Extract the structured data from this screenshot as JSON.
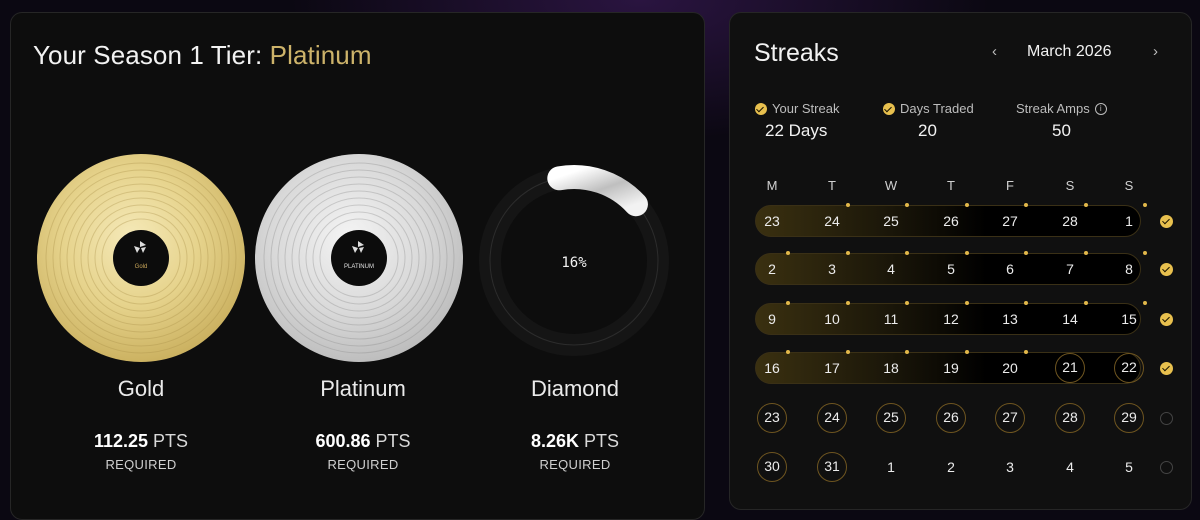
{
  "tier": {
    "title_prefix": "Your Season 1 Tier: ",
    "current": "Platinum",
    "tiers": [
      {
        "name": "Gold",
        "pts": "112.25",
        "unit": "PTS",
        "req": "REQUIRED",
        "label_text": "Gold"
      },
      {
        "name": "Platinum",
        "pts": "600.86",
        "unit": "PTS",
        "req": "REQUIRED",
        "label_text": "PLATINUM"
      },
      {
        "name": "Diamond",
        "pts": "8.26K",
        "unit": "PTS",
        "req": "REQUIRED",
        "progress_text": "16%",
        "progress": 0.16
      }
    ]
  },
  "streaks": {
    "title": "Streaks",
    "month": "March 2026",
    "your_streak_label": "Your Streak",
    "your_streak_value": "22 Days",
    "days_traded_label": "Days Traded",
    "days_traded_value": "20",
    "streak_amps_label": "Streak Amps",
    "streak_amps_value": "50",
    "weekdays": [
      "M",
      "T",
      "W",
      "T",
      "F",
      "S",
      "S"
    ],
    "weeks": [
      {
        "days": [
          "23",
          "24",
          "25",
          "26",
          "27",
          "28",
          "1"
        ],
        "completed": true
      },
      {
        "days": [
          "2",
          "3",
          "4",
          "5",
          "6",
          "7",
          "8"
        ],
        "completed": true
      },
      {
        "days": [
          "9",
          "10",
          "11",
          "12",
          "13",
          "14",
          "15"
        ],
        "completed": true
      },
      {
        "days": [
          "16",
          "17",
          "18",
          "19",
          "20",
          "21",
          "22"
        ],
        "completed": true
      },
      {
        "days": [
          "23",
          "24",
          "25",
          "26",
          "27",
          "28",
          "29"
        ],
        "completed": false
      },
      {
        "days": [
          "30",
          "31",
          "1",
          "2",
          "3",
          "4",
          "5"
        ],
        "completed": false
      }
    ]
  },
  "colors": {
    "accent_gold": "#e8c04e",
    "platinum_text": "#cdb36a"
  }
}
